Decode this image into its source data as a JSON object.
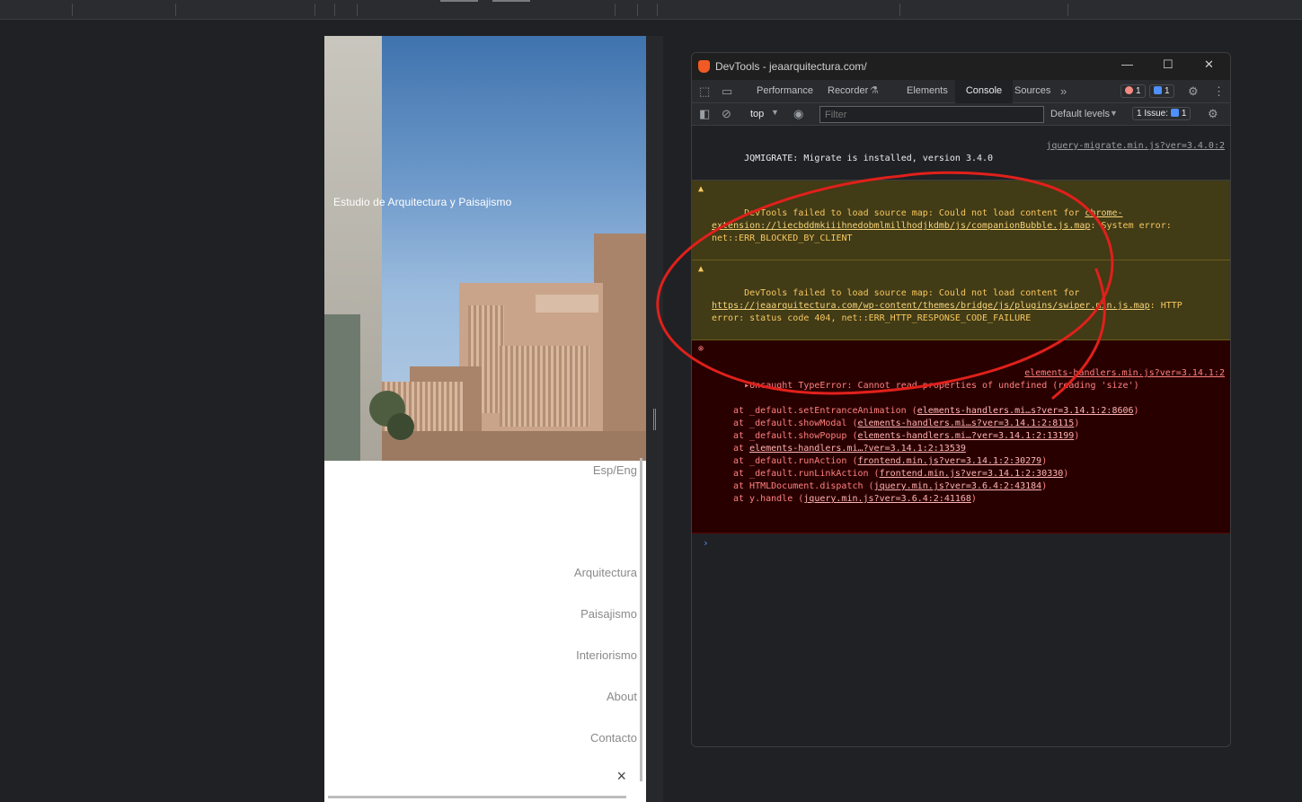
{
  "website": {
    "hero_caption": "Estudio de Arquitectura y Paisajismo",
    "language_switch": "Esp/Eng",
    "menu_items": [
      "Arquitectura",
      "Paisajismo",
      "Interiorismo",
      "About",
      "Contacto"
    ],
    "close_icon": "×"
  },
  "devtools": {
    "title": "DevTools - jeaarquitectura.com/",
    "window_controls": {
      "minimize": "—",
      "maximize": "☐",
      "close": "✕"
    },
    "tabs": [
      "Performance",
      "Recorder",
      "Elements",
      "Console",
      "Sources"
    ],
    "active_tab": "Console",
    "more_tabs": "»",
    "error_count": "1",
    "message_count": "1",
    "context": "top",
    "filter_placeholder": "Filter",
    "levels": "Default levels",
    "issues_label": "1 Issue:",
    "issues_count": "1",
    "colors": {
      "error": "#ff8080",
      "warning": "#f7c75f",
      "accent": "#4d90fe",
      "annotation": "#e0201b"
    },
    "messages": {
      "info": {
        "text": "JQMIGRATE: Migrate is installed, version 3.4.0",
        "source": "jquery-migrate.min.js?ver=3.4.0:2"
      },
      "warn1": {
        "prefix": "DevTools failed to load source map: Could not load content for ",
        "url": "chrome-extension://liecbddmkiiihnedobmlmillhodjkdmb/js/companionBubble.js.map",
        "suffix": ": System error: net::ERR_BLOCKED_BY_CLIENT"
      },
      "warn2": {
        "prefix": "DevTools failed to load source map: Could not load content for ",
        "url": "https://jeaarquitectura.com/wp-content/themes/bridge/js/plugins/swiper.min.js.map",
        "suffix": ": HTTP error: status code 404, net::ERR_HTTP_RESPONSE_CODE_FAILURE"
      },
      "error": {
        "text": "▸Uncaught TypeError: Cannot read properties of undefined (reading 'size')",
        "source": "elements-handlers.min.js?ver=3.14.1:2",
        "stack": [
          {
            "fn": "at _default.setEntranceAnimation (",
            "loc": "elements-handlers.mi…s?ver=3.14.1:2:8606",
            "end": ")"
          },
          {
            "fn": "at _default.showModal (",
            "loc": "elements-handlers.mi…s?ver=3.14.1:2:8115",
            "end": ")"
          },
          {
            "fn": "at _default.showPopup (",
            "loc": "elements-handlers.mi…?ver=3.14.1:2:13199",
            "end": ")"
          },
          {
            "fn": "at ",
            "loc": "elements-handlers.mi…?ver=3.14.1:2:13539",
            "end": ""
          },
          {
            "fn": "at _default.runAction (",
            "loc": "frontend.min.js?ver=3.14.1:2:30279",
            "end": ")"
          },
          {
            "fn": "at _default.runLinkAction (",
            "loc": "frontend.min.js?ver=3.14.1:2:30330",
            "end": ")"
          },
          {
            "fn": "at HTMLDocument.dispatch (",
            "loc": "jquery.min.js?ver=3.6.4:2:43184",
            "end": ")"
          },
          {
            "fn": "at y.handle (",
            "loc": "jquery.min.js?ver=3.6.4:2:41168",
            "end": ")"
          }
        ]
      }
    },
    "prompt": "›"
  }
}
